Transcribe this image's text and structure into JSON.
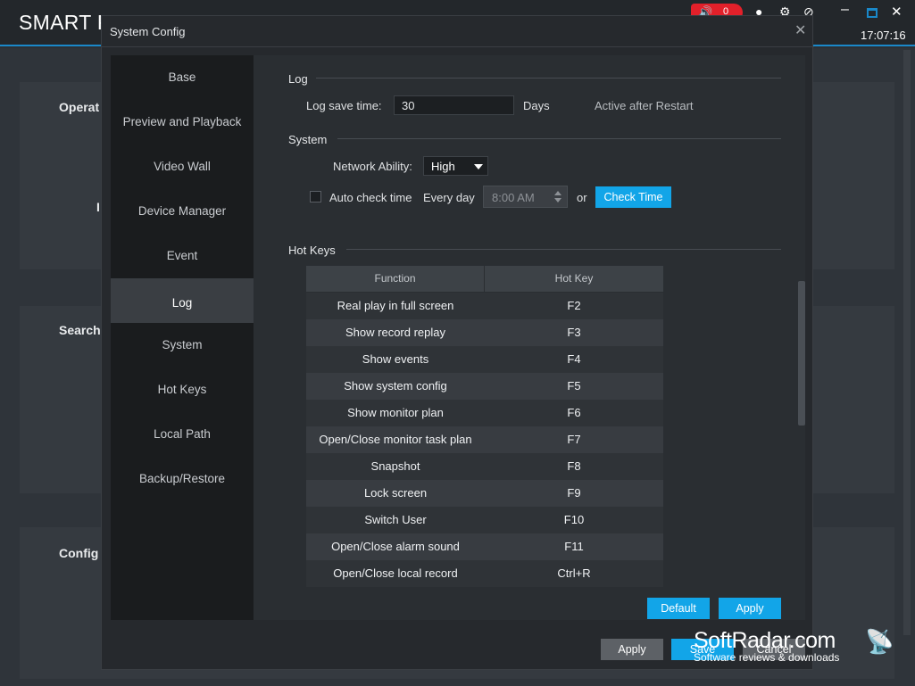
{
  "app": {
    "title": "SMART P",
    "alarm_count": "0",
    "clock": "17:07:16",
    "bg_labels": [
      "Operat",
      "I",
      "Search",
      "Config"
    ]
  },
  "dialog": {
    "title": "System Config",
    "close": "✕"
  },
  "nav": {
    "items": [
      {
        "label": "Base"
      },
      {
        "label": "Preview and Playback"
      },
      {
        "label": "Video Wall"
      },
      {
        "label": "Device Manager"
      },
      {
        "label": "Event"
      },
      {
        "label": "Log"
      },
      {
        "label": "System"
      },
      {
        "label": "Hot Keys"
      },
      {
        "label": "Local Path"
      },
      {
        "label": "Backup/Restore"
      }
    ],
    "active": "Log"
  },
  "log": {
    "section_title": "Log",
    "save_time_label": "Log save time:",
    "save_time_value": "30",
    "unit": "Days",
    "note": "Active after Restart"
  },
  "system": {
    "section_title": "System",
    "network_ability_label": "Network Ability:",
    "network_ability_value": "High",
    "auto_check_label": "Auto check time",
    "auto_check_checked": false,
    "frequency": "Every day",
    "time_value": "8:00 AM",
    "or_label": "or",
    "check_time_button": "Check Time"
  },
  "hotkeys": {
    "section_title": "Hot Keys",
    "columns": [
      "Function",
      "Hot Key"
    ],
    "rows": [
      {
        "function": "Real play in full screen",
        "key": "F2"
      },
      {
        "function": "Show record replay",
        "key": "F3"
      },
      {
        "function": "Show events",
        "key": "F4"
      },
      {
        "function": "Show system config",
        "key": "F5"
      },
      {
        "function": "Show monitor plan",
        "key": "F6"
      },
      {
        "function": "Open/Close monitor task plan",
        "key": "F7"
      },
      {
        "function": "Snapshot",
        "key": "F8"
      },
      {
        "function": "Lock screen",
        "key": "F9"
      },
      {
        "function": "Switch User",
        "key": "F10"
      },
      {
        "function": "Open/Close alarm sound",
        "key": "F11"
      },
      {
        "function": "Open/Close local record",
        "key": "Ctrl+R"
      }
    ]
  },
  "buttons": {
    "default": "Default",
    "apply_inner": "Apply",
    "apply": "Apply",
    "save": "Save",
    "cancel": "Cancel"
  },
  "watermark": {
    "title": "SoftRadar.com",
    "subtitle": "Software reviews & downloads"
  },
  "colors": {
    "accent": "#12a5e8",
    "alarm": "#e2202a"
  }
}
